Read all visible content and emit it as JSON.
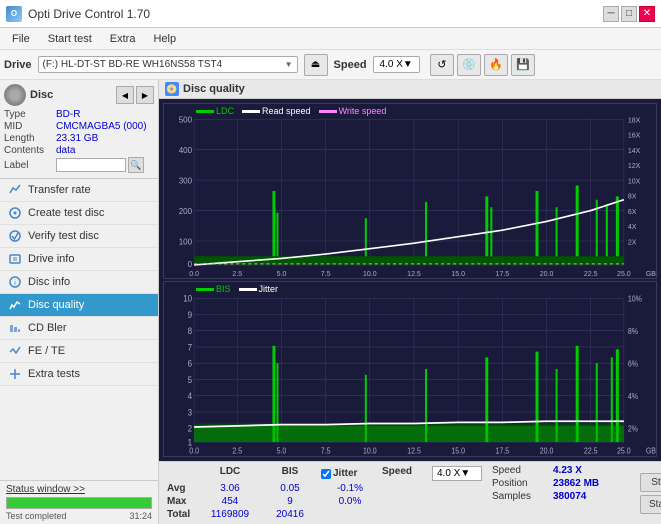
{
  "titleBar": {
    "appName": "Opti Drive Control 1.70",
    "controls": [
      "─",
      "□",
      "✕"
    ]
  },
  "menuBar": {
    "items": [
      "File",
      "Start test",
      "Extra",
      "Help"
    ]
  },
  "driveBar": {
    "label": "Drive",
    "driveText": "(F:)  HL-DT-ST BD-RE  WH16NS58 TST4",
    "speedLabel": "Speed",
    "speedValue": "4.0 X"
  },
  "disc": {
    "label": "Disc",
    "type": {
      "key": "Type",
      "value": "BD-R"
    },
    "mid": {
      "key": "MID",
      "value": "CMCMAGBA5 (000)"
    },
    "length": {
      "key": "Length",
      "value": "23.31 GB"
    },
    "contents": {
      "key": "Contents",
      "value": "data"
    },
    "labelKey": "Label",
    "labelValue": ""
  },
  "navItems": [
    {
      "id": "transfer-rate",
      "label": "Transfer rate",
      "active": false
    },
    {
      "id": "create-test-disc",
      "label": "Create test disc",
      "active": false
    },
    {
      "id": "verify-test-disc",
      "label": "Verify test disc",
      "active": false
    },
    {
      "id": "drive-info",
      "label": "Drive info",
      "active": false
    },
    {
      "id": "disc-info",
      "label": "Disc info",
      "active": false
    },
    {
      "id": "disc-quality",
      "label": "Disc quality",
      "active": true
    },
    {
      "id": "cd-bler",
      "label": "CD Bler",
      "active": false
    },
    {
      "id": "fe-te",
      "label": "FE / TE",
      "active": false
    },
    {
      "id": "extra-tests",
      "label": "Extra tests",
      "active": false
    }
  ],
  "statusBar": {
    "statusWindowLabel": "Status window >>",
    "progressPercent": 100,
    "statusText": "Test completed"
  },
  "discQuality": {
    "title": "Disc quality",
    "legend1": {
      "ldc": "LDC",
      "readSpeed": "Read speed",
      "writeSpeed": "Write speed"
    },
    "legend2": {
      "bis": "BIS",
      "jitter": "Jitter"
    },
    "xAxisLabel": "GB",
    "chart1": {
      "yMax": 500,
      "yAxisLabels": [
        "500",
        "400",
        "300",
        "200",
        "100",
        "0"
      ],
      "yAxisRight": [
        "18X",
        "16X",
        "14X",
        "12X",
        "10X",
        "8X",
        "6X",
        "4X",
        "2X"
      ],
      "xAxisLabels": [
        "0.0",
        "2.5",
        "5.0",
        "7.5",
        "10.0",
        "12.5",
        "15.0",
        "17.5",
        "20.0",
        "22.5",
        "25.0"
      ]
    },
    "chart2": {
      "yAxisLabels": [
        "10",
        "9",
        "8",
        "7",
        "6",
        "5",
        "4",
        "3",
        "2",
        "1"
      ],
      "yAxisRight": [
        "10%",
        "8%",
        "6%",
        "4%",
        "2%"
      ],
      "xAxisLabels": [
        "0.0",
        "2.5",
        "5.0",
        "7.5",
        "10.0",
        "12.5",
        "15.0",
        "17.5",
        "20.0",
        "22.5",
        "25.0"
      ]
    }
  },
  "stats": {
    "headers": [
      "",
      "LDC",
      "BIS",
      "",
      "Jitter",
      "Speed",
      "",
      ""
    ],
    "avgLabel": "Avg",
    "avgLDC": "3.06",
    "avgBIS": "0.05",
    "avgJitter": "-0.1%",
    "maxLabel": "Max",
    "maxLDC": "454",
    "maxBIS": "9",
    "maxJitter": "0.0%",
    "totalLabel": "Total",
    "totalLDC": "1169809",
    "totalBIS": "20416",
    "jitterChecked": true,
    "jitterLabel": "Jitter",
    "speedLabel": "Speed",
    "speedValue": "4.23 X",
    "speedDropdown": "4.0 X",
    "positionLabel": "Position",
    "positionValue": "23862 MB",
    "samplesLabel": "Samples",
    "samplesValue": "380074",
    "startFullLabel": "Start full",
    "startPartLabel": "Start part"
  },
  "colors": {
    "ldc": "#00cc00",
    "readSpeed": "#ffffff",
    "writeSpeed": "#ff88ff",
    "bis": "#00cc00",
    "jitter": "#ffffff",
    "gridLine": "#3a3a6a",
    "chartBg": "#1a1a3a",
    "accent": "#3399cc"
  },
  "time": "31:24"
}
